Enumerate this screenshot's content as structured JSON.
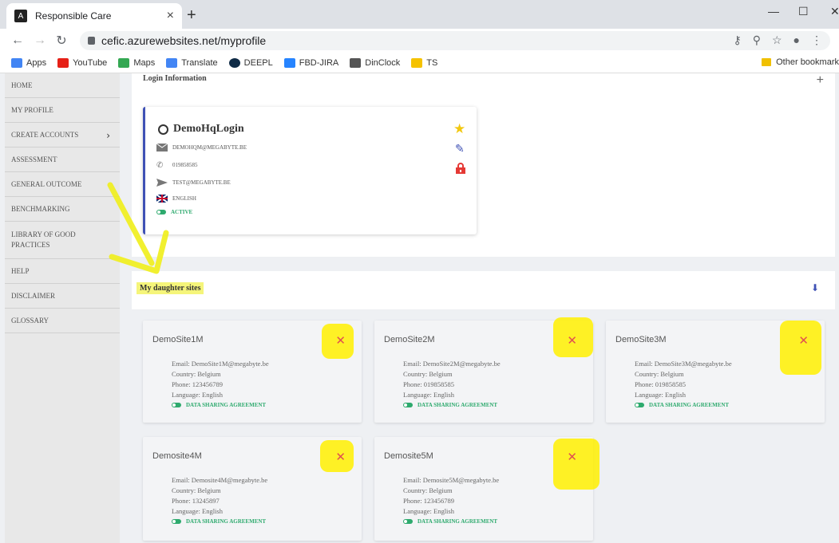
{
  "browser": {
    "tab_title": "Responsible Care",
    "url": "cefic.azurewebsites.net/myprofile",
    "bookmarks": [
      "Apps",
      "YouTube",
      "Maps",
      "Translate",
      "DEEPL",
      "FBD-JIRA",
      "DinClock",
      "TS"
    ],
    "other_bookmarks": "Other bookmark"
  },
  "sidebar": {
    "items": [
      {
        "label": "HOME"
      },
      {
        "label": "MY PROFILE"
      },
      {
        "label": "CREATE ACCOUNTS"
      },
      {
        "label": "ASSESSMENT"
      },
      {
        "label": "GENERAL OUTCOME"
      },
      {
        "label": "BENCHMARKING"
      },
      {
        "label": "LIBRARY OF GOOD PRACTICES"
      },
      {
        "label": "HELP"
      },
      {
        "label": "DISCLAIMER"
      },
      {
        "label": "GLOSSARY"
      }
    ]
  },
  "login": {
    "section_title": "Login Information",
    "name": "DemoHqLogin",
    "email": "DEMOHQM@MEGABYTE.BE",
    "phone": "019858585",
    "contact": "TEST@MEGABYTE.BE",
    "language": "ENGLISH",
    "status": "ACTIVE"
  },
  "daughters": {
    "section_title": "My daughter sites",
    "sites": [
      {
        "name": "DemoSite1M",
        "email": "Email: DemoSite1M@megabyte.be",
        "country": "Country: Belgium",
        "phone": "Phone: 123456789",
        "language": "Language: English",
        "agreement": "DATA SHARING AGREEMENT"
      },
      {
        "name": "DemoSite2M",
        "email": "Email: DemoSite2M@megabyte.be",
        "country": "Country: Belgium",
        "phone": "Phone: 019858585",
        "language": "Language: English",
        "agreement": "DATA SHARING AGREEMENT"
      },
      {
        "name": "DemoSite3M",
        "email": "Email: DemoSite3M@megabyte.be",
        "country": "Country: Belgium",
        "phone": "Phone: 019858585",
        "language": "Language: English",
        "agreement": "DATA SHARING AGREEMENT"
      },
      {
        "name": "Demosite4M",
        "email": "Email: Demosite4M@megabyte.be",
        "country": "Country: Belgium",
        "phone": "Phone: 13245897",
        "language": "Language: English",
        "agreement": "DATA SHARING AGREEMENT"
      },
      {
        "name": "Demosite5M",
        "email": "Email: Demosite5M@megabyte.be",
        "country": "Country: Belgium",
        "phone": "Phone: 123456789",
        "language": "Language: English",
        "agreement": "DATA SHARING AGREEMENT"
      }
    ]
  },
  "colors": {
    "accent": "#3f51b5",
    "active": "#2eaa6e",
    "delete": "#e05050",
    "highlight": "#f5f000"
  }
}
